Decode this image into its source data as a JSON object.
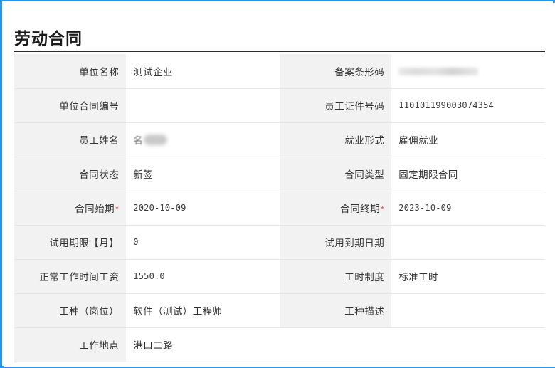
{
  "page": {
    "title": "劳动合同",
    "accent_border_color": "#2196f3",
    "label_bg_color": "#f2f2f2",
    "required_star_color": "#e64545",
    "required_star": "*"
  },
  "rows": [
    {
      "left": {
        "label": "单位名称",
        "value": "测试企业",
        "required": false,
        "redacted": false,
        "mono": false
      },
      "right": {
        "label": "备案条形码",
        "value": "",
        "required": false,
        "redacted": "barcode",
        "mono": false
      }
    },
    {
      "left": {
        "label": "单位合同编号",
        "value": "",
        "required": false,
        "redacted": false,
        "mono": false
      },
      "right": {
        "label": "员工证件号码",
        "value": "110101199003074354",
        "required": false,
        "redacted": false,
        "mono": true
      }
    },
    {
      "left": {
        "label": "员工姓名",
        "value": "名",
        "required": false,
        "redacted": "name",
        "mono": false
      },
      "right": {
        "label": "就业形式",
        "value": "雇佣就业",
        "required": false,
        "redacted": false,
        "mono": false
      }
    },
    {
      "left": {
        "label": "合同状态",
        "value": "新签",
        "required": false,
        "redacted": false,
        "mono": false
      },
      "right": {
        "label": "合同类型",
        "value": "固定期限合同",
        "required": false,
        "redacted": false,
        "mono": false
      }
    },
    {
      "left": {
        "label": "合同始期",
        "value": "2020-10-09",
        "required": true,
        "redacted": false,
        "mono": true
      },
      "right": {
        "label": "合同终期",
        "value": "2023-10-09",
        "required": true,
        "redacted": false,
        "mono": true
      }
    },
    {
      "left": {
        "label": "试用期限【月】",
        "value": "0",
        "required": false,
        "redacted": false,
        "mono": true
      },
      "right": {
        "label": "试用到期日期",
        "value": "",
        "required": false,
        "redacted": false,
        "mono": false
      }
    },
    {
      "left": {
        "label": "正常工作时间工资",
        "value": "1550.0",
        "required": false,
        "redacted": false,
        "mono": true
      },
      "right": {
        "label": "工时制度",
        "value": "标准工时",
        "required": false,
        "redacted": false,
        "mono": false
      }
    },
    {
      "left": {
        "label": "工种（岗位）",
        "value": "软件（测试）工程师",
        "required": false,
        "redacted": false,
        "mono": false
      },
      "right": {
        "label": "工种描述",
        "value": "",
        "required": false,
        "redacted": false,
        "mono": false
      }
    }
  ],
  "last_row": {
    "label": "工作地点",
    "value": "港口二路"
  }
}
